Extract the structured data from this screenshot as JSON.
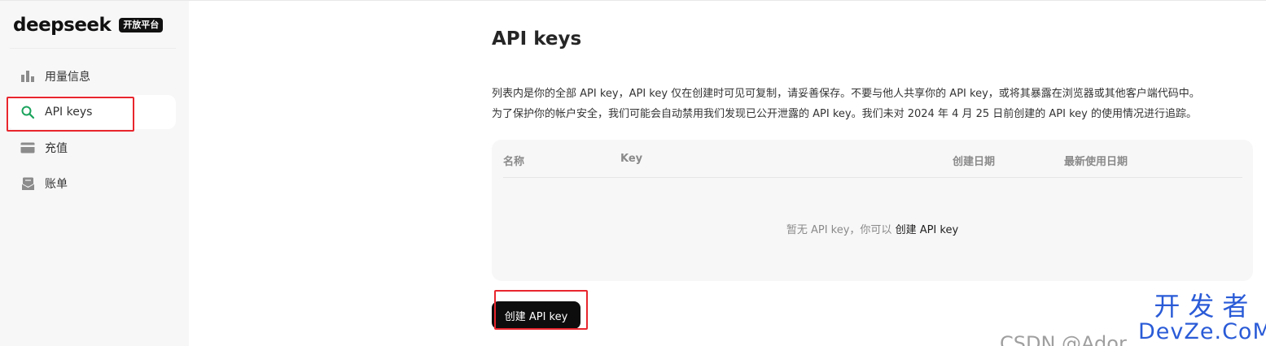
{
  "brand": {
    "logo_text": "deepseek",
    "badge": "开放平台"
  },
  "sidebar": {
    "items": [
      {
        "label": "用量信息",
        "icon": "bar-chart-icon",
        "active": false
      },
      {
        "label": "API keys",
        "icon": "key-search-icon",
        "active": true
      },
      {
        "label": "充值",
        "icon": "card-icon",
        "active": false
      },
      {
        "label": "账单",
        "icon": "bill-icon",
        "active": false
      }
    ]
  },
  "main": {
    "title": "API keys",
    "description": [
      "列表内是你的全部 API key，API key 仅在创建时可见可复制，请妥善保存。不要与他人共享你的 API key，或将其暴露在浏览器或其他客户端代码中。",
      "为了保护你的帐户安全，我们可能会自动禁用我们发现已公开泄露的 API key。我们未对 2024 年 4 月 25 日前创建的 API key 的使用情况进行追踪。"
    ],
    "table": {
      "columns": [
        "名称",
        "Key",
        "创建日期",
        "最新使用日期"
      ],
      "empty_text": "暂无 API key，你可以",
      "empty_link": "创建 API key"
    },
    "create_button": "创建 API key"
  },
  "watermark": {
    "csdn": "CSDN @Ador",
    "site_cn": "开发者",
    "site_en": "DevZe.CoM"
  },
  "colors": {
    "accent_green": "#1aa35c",
    "highlight_red": "#e8262d",
    "button_black": "#0d0d0d",
    "watermark_blue": "#2a5bd7"
  }
}
